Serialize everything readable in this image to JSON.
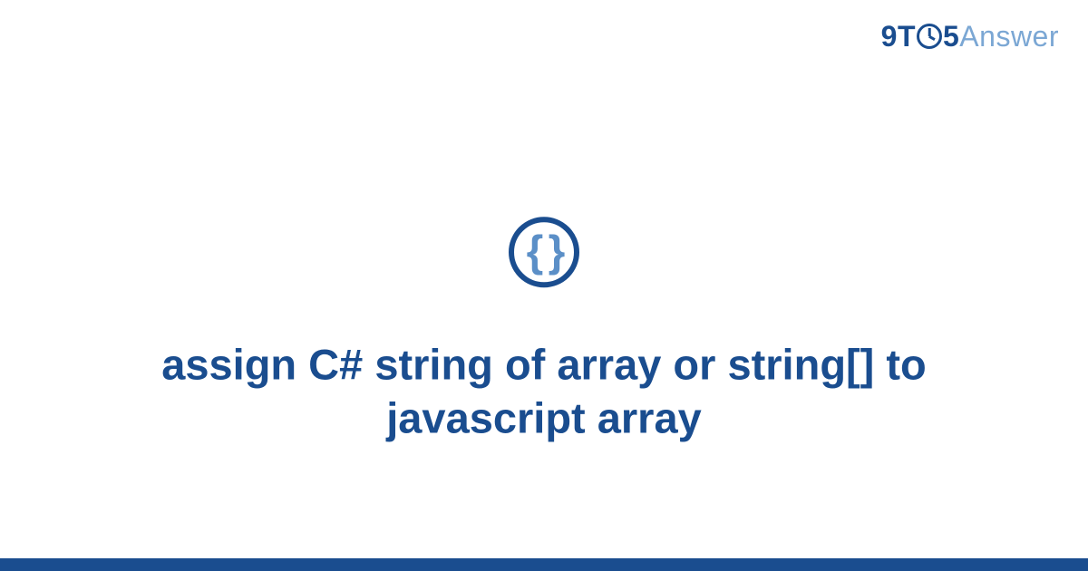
{
  "logo": {
    "part1": "9T",
    "part2": "5",
    "part3": "Answer"
  },
  "icon": {
    "braces": "{ }"
  },
  "title": "assign C# string of array or string[] to javascript array"
}
